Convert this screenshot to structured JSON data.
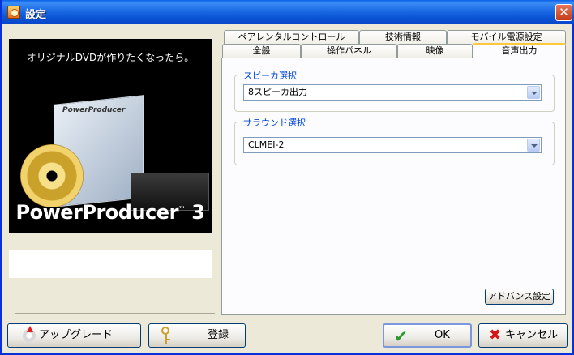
{
  "window": {
    "title": "設定",
    "close_symbol": "✕",
    "app_icon": "powerproducer-app-icon",
    "title_bar_color": "#0b56d6"
  },
  "banner": {
    "headline": "オリジナルDVDが作りたくなったら。",
    "product_name": "PowerProducer",
    "product_version": "3",
    "box_title": "PowerProducer"
  },
  "tabs": {
    "row_back": [
      {
        "label": "ペアレンタルコントロール"
      },
      {
        "label": "技術情報"
      },
      {
        "label": "モバイル電源設定"
      }
    ],
    "row_front": [
      {
        "label": "全般"
      },
      {
        "label": "操作パネル"
      },
      {
        "label": "映像"
      },
      {
        "label": "音声出力",
        "selected": true
      }
    ]
  },
  "speaker_group": {
    "legend": "スピーカ選択",
    "selected_value": "8スピーカ出力"
  },
  "surround_group": {
    "legend": "サラウンド選択",
    "selected_value": "CLMEI-2"
  },
  "advanced_button": {
    "label": "アドバンス設定"
  },
  "bottom_buttons": {
    "upgrade": {
      "label": "アップグレード",
      "icon": "upgrade-disc-icon"
    },
    "register": {
      "label": "登録",
      "icon": "key-icon"
    },
    "ok": {
      "label": "OK",
      "icon": "check-icon",
      "icon_glyph": "✔"
    },
    "cancel": {
      "label": "キャンセル",
      "icon": "x-icon",
      "icon_glyph": "✖"
    }
  },
  "colors": {
    "legend_text": "#0046d5",
    "selected_tab_accent": "#ffc83c",
    "ok_check": "#2e9a2e",
    "cancel_x": "#d01818"
  }
}
